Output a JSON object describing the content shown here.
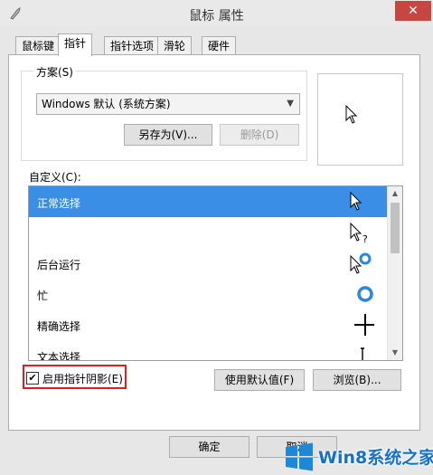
{
  "window": {
    "title": "鼠标 属性",
    "close_glyph": "✕"
  },
  "tabs": [
    {
      "label": "鼠标键"
    },
    {
      "label": "指针"
    },
    {
      "label": "指针选项"
    },
    {
      "label": "滑轮"
    },
    {
      "label": "硬件"
    }
  ],
  "active_tab": "指针",
  "scheme": {
    "group_label": "方案(S)",
    "selected": "Windows 默认 (系统方案)",
    "save_as_label": "另存为(V)...",
    "delete_label": "删除(D)"
  },
  "customize": {
    "label": "自定义(C):",
    "items": [
      {
        "label": "正常选择",
        "cursor": "arrow-cursor-icon",
        "selected": true
      },
      {
        "label": "",
        "cursor": "help-cursor-icon",
        "selected": false
      },
      {
        "label": "后台运行",
        "cursor": "working-in-background-cursor-icon",
        "selected": false
      },
      {
        "label": "忙",
        "cursor": "busy-cursor-icon",
        "selected": false
      },
      {
        "label": "精确选择",
        "cursor": "precision-cursor-icon",
        "selected": false
      },
      {
        "label": "文本选择",
        "cursor": "text-cursor-icon",
        "selected": false
      }
    ]
  },
  "shadow_checkbox": {
    "label": "启用指针阴影(E)",
    "checked": true
  },
  "use_default_label": "使用默认值(F)",
  "browse_label": "浏览(B)...",
  "ok_label": "确定",
  "cancel_label": "取消",
  "watermark_text": "Win8系统之家",
  "colors": {
    "selection": "#3a8ee6",
    "close": "#c7463f",
    "highlight": "#e31d1d",
    "win_logo": "#1e88d8"
  }
}
